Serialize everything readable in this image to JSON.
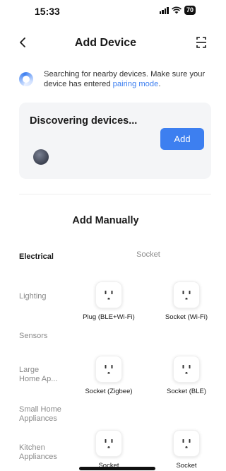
{
  "status_bar": {
    "time": "15:33",
    "battery": "70"
  },
  "nav": {
    "title": "Add Device"
  },
  "search": {
    "text": "Searching for nearby devices. Make sure your device has entered",
    "link": "pairing mode",
    "suffix": "."
  },
  "discover": {
    "title": "Discovering devices...",
    "add_label": "Add"
  },
  "manual": {
    "title": "Add Manually",
    "subcategory": "Socket"
  },
  "categories": [
    {
      "label": "Electrical",
      "active": true
    },
    {
      "label": "Lighting",
      "active": false
    },
    {
      "label": "Sensors",
      "active": false
    },
    {
      "label": "Large Home Ap...",
      "active": false
    },
    {
      "label": "Small Home Appliances",
      "active": false
    },
    {
      "label": "Kitchen Appliances",
      "active": false
    }
  ],
  "devices": [
    {
      "label": "Plug (BLE+Wi-Fi)",
      "icon": "plug-icon"
    },
    {
      "label": "Socket (Wi-Fi)",
      "icon": "plug-icon"
    },
    {
      "label": "Socket (Zigbee)",
      "icon": "plug-icon"
    },
    {
      "label": "Socket (BLE)",
      "icon": "plug-icon"
    },
    {
      "label": "Socket",
      "icon": "plug-icon"
    },
    {
      "label": "Socket",
      "icon": "plug-icon"
    }
  ],
  "colors": {
    "accent": "#3d7ff0",
    "card_bg": "#f4f5f7"
  }
}
